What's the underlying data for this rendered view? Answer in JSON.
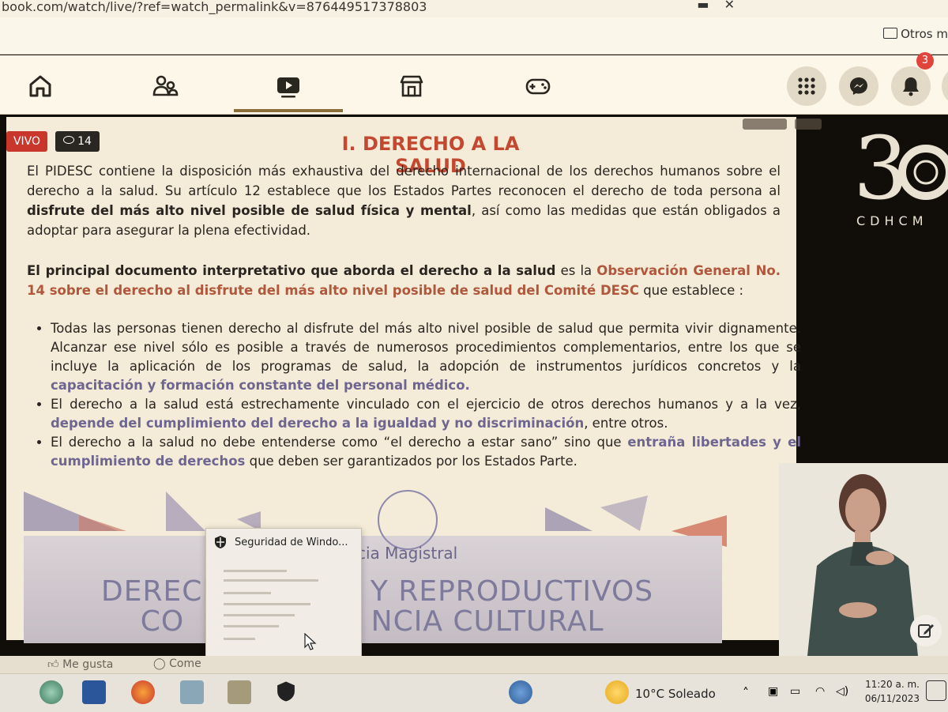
{
  "browser": {
    "url": "book.com/watch/live/?ref=watch_permalink&v=876449517378803",
    "bookmark_folder": "Otros m"
  },
  "live": {
    "status": "VIVO",
    "viewers": "14"
  },
  "slide": {
    "title": "I. DERECHO A LA SALUD",
    "p1_a": "El PIDESC contiene la disposición más exhaustiva del derecho internacional de los derechos humanos sobre el derecho a la salud. Su artículo 12 establece que los Estados Partes reconocen el derecho de toda persona al ",
    "p1_bold": "disfrute del más alto nivel posible de salud física y mental",
    "p1_b": ", así como las medidas que están obligados a adoptar para asegurar la plena efectividad.",
    "p2_bold": "El principal documento interpretativo que aborda el derecho a la salud",
    "p2_a": " es la ",
    "p2_accent": "Observación General No. 14 sobre el derecho al disfrute del más alto nivel posible de salud del Comité DESC",
    "p2_b": " que establece :",
    "b1_a": "Todas las personas tienen derecho al disfrute del más alto nivel posible de salud que permita vivir dignamente. Alcanzar ese nivel sólo es posible a través de numerosos procedimientos complementarios, entre los que se incluye la aplicación de los programas de salud, la adopción de instrumentos jurídicos concretos y la ",
    "b1_purple": "capacitación y formación constante del personal médico.",
    "b2_a": "El derecho a la salud está estrechamente vinculado con el ejercicio de otros derechos humanos y a la vez, ",
    "b2_purple": "depende del cumplimiento del derecho a la igualdad y no discriminación",
    "b2_b": ", entre otros.",
    "b3_a": "El derecho a la salud no debe entenderse como “el derecho a estar sano” sino que ",
    "b3_purple1": "entraña libertades y el cumplimiento de derechos",
    "b3_b": " que deben ser garantizados por los Estados Parte.",
    "banner_magistral": "cia Magistral",
    "banner_line1": "DERECH          ES Y REPRODUCTIVOS",
    "banner_line2": "    CO                   NCIA CULTURAL"
  },
  "logo": {
    "text": "CDHCM"
  },
  "popup": {
    "title": "Seguridad de Windo..."
  },
  "reactions": {
    "like": "Me gusta",
    "comment": "Come"
  },
  "taskbar": {
    "weather": "10°C  Soleado",
    "time": "11:20 a. m.",
    "date": "06/11/2023"
  },
  "colors": {
    "live_red": "#c9372c",
    "title_accent": "#c44830",
    "purple_text": "#6e6690",
    "notification_badge": "#e0443a"
  },
  "notifications": {
    "count": "3"
  }
}
